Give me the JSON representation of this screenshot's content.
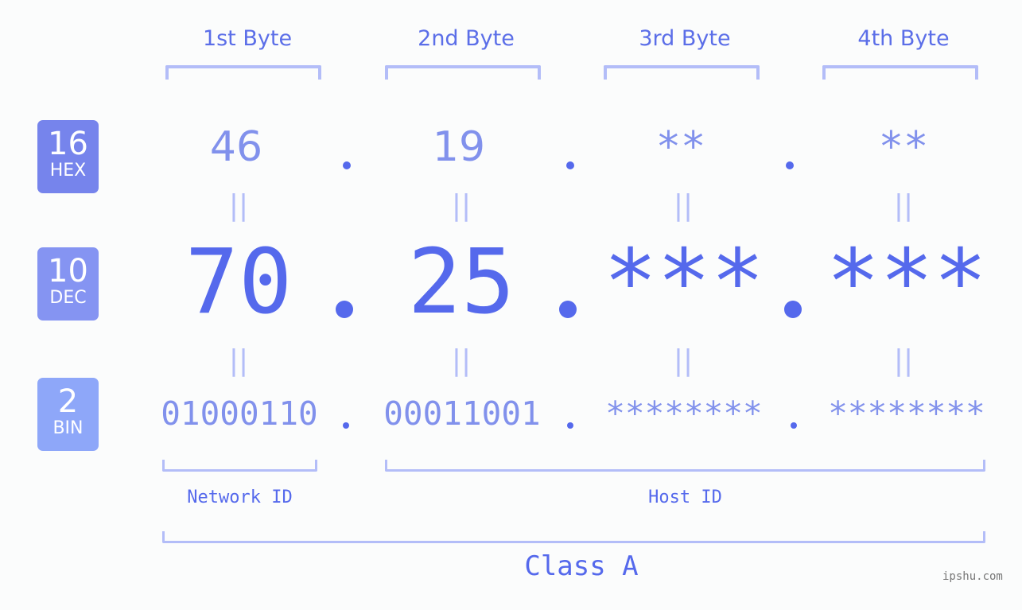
{
  "bytes": [
    {
      "header": "1st Byte",
      "hex": "46",
      "dec": "70",
      "bin": "01000110"
    },
    {
      "header": "2nd Byte",
      "hex": "19",
      "dec": "25",
      "bin": "00011001"
    },
    {
      "header": "3rd Byte",
      "hex": "**",
      "dec": "***",
      "bin": "********"
    },
    {
      "header": "4th Byte",
      "hex": "**",
      "dec": "***",
      "bin": "********"
    }
  ],
  "badges": {
    "hex": {
      "base": "16",
      "label": "HEX",
      "color": "#7684ec"
    },
    "dec": {
      "base": "10",
      "label": "DEC",
      "color": "#8594f2"
    },
    "bin": {
      "base": "2",
      "label": "BIN",
      "color": "#8ea7f9"
    }
  },
  "equals_glyph": "||",
  "labels": {
    "network_id": "Network ID",
    "host_id": "Host ID",
    "class": "Class A"
  },
  "watermark": "ipshu.com",
  "colors": {
    "accent": "#5569ec",
    "secondary": "#8191ec",
    "bracket": "#b3bdf8"
  }
}
